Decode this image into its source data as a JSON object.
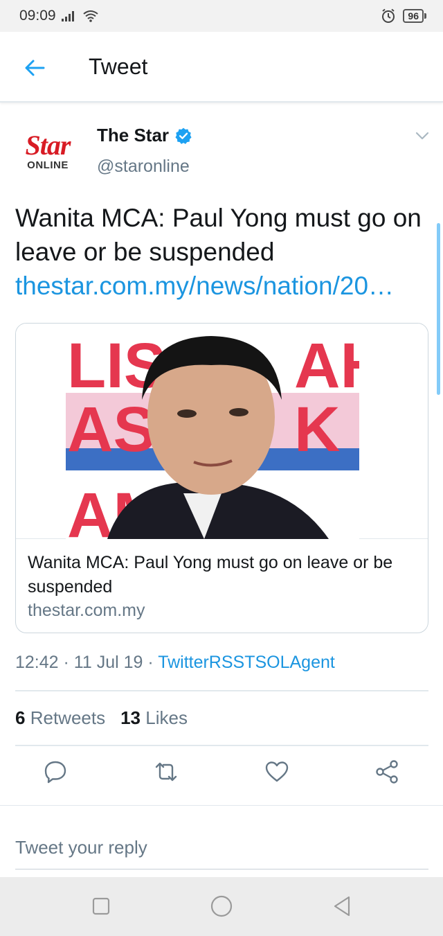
{
  "status_bar": {
    "time": "09:09",
    "battery": "96"
  },
  "header": {
    "title": "Tweet"
  },
  "tweet": {
    "author": {
      "name": "The Star",
      "handle": "@staronline",
      "avatar_top": "Star",
      "avatar_bottom": "ONLINE"
    },
    "text": "Wanita MCA: Paul Yong must go on leave or be suspended",
    "link": "thestar.com.my/news/nation/20…",
    "card": {
      "title": "Wanita MCA: Paul Yong must go on leave or be suspended",
      "domain": "thestar.com.my"
    },
    "time": "12:42",
    "separator": "·",
    "date": "11 Jul 19",
    "via": "TwitterRSSTSOLAgent",
    "retweets": "6",
    "retweets_label": "Retweets",
    "likes": "13",
    "likes_label": "Likes"
  },
  "reply": {
    "placeholder": "Tweet your reply"
  },
  "colors": {
    "accent": "#1da1f2",
    "link": "#1b95e0",
    "muted": "#657786",
    "brand_red": "#d81b24"
  },
  "icons": [
    "back-arrow-icon",
    "verified-icon",
    "chevron-down-icon",
    "reply-icon",
    "retweet-icon",
    "like-icon",
    "share-icon",
    "nav-recents-icon",
    "nav-home-icon",
    "nav-back-icon",
    "alarm-icon",
    "signal-icon",
    "wifi-icon"
  ]
}
